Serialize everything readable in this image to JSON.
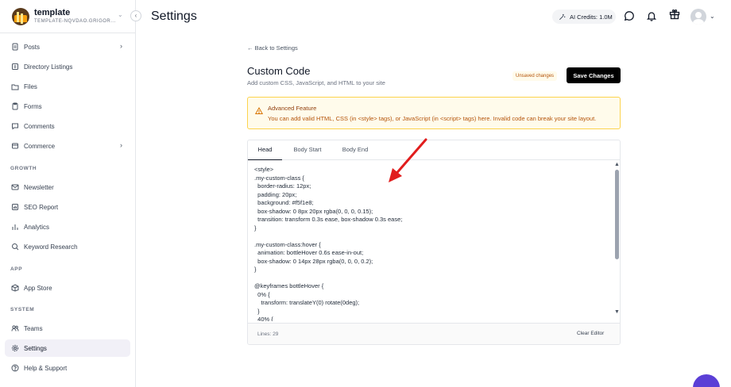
{
  "brand": {
    "name": "template",
    "subtitle": "TEMPLATE-NQVDAO.GRIGOR..."
  },
  "sidebar": {
    "items": [
      {
        "label": "Posts",
        "icon": "document-icon"
      },
      {
        "label": "Directory Listings",
        "icon": "list-icon"
      },
      {
        "label": "Files",
        "icon": "folder-icon"
      },
      {
        "label": "Forms",
        "icon": "clipboard-icon"
      },
      {
        "label": "Comments",
        "icon": "chat-icon"
      },
      {
        "label": "Commerce",
        "icon": "cart-icon"
      },
      {
        "label": "Newsletter",
        "icon": "mail-icon"
      },
      {
        "label": "SEO Report",
        "icon": "chart-icon"
      },
      {
        "label": "Analytics",
        "icon": "analytics-icon"
      },
      {
        "label": "Keyword Research",
        "icon": "search-icon"
      },
      {
        "label": "App Store",
        "icon": "box-icon"
      },
      {
        "label": "Teams",
        "icon": "users-icon"
      },
      {
        "label": "Settings",
        "icon": "gear-icon"
      },
      {
        "label": "Help & Support",
        "icon": "help-icon"
      }
    ],
    "sections": {
      "growth": "GROWTH",
      "app": "APP",
      "system": "SYSTEM"
    },
    "active": "Settings"
  },
  "header": {
    "title": "Settings",
    "credits": "AI Credits: 1.0M"
  },
  "main": {
    "back_link": "← Back to Settings",
    "title": "Custom Code",
    "description": "Add custom CSS, JavaScript, and HTML to your site",
    "unsaved": "Unsaved changes",
    "save_label": "Save Changes",
    "alert": {
      "title": "Advanced Feature",
      "text": "You can add valid HTML, CSS (in <style> tags), or JavaScript (in <script> tags) here. Invalid code can break your site layout."
    },
    "tabs": [
      {
        "label": "Head"
      },
      {
        "label": "Body Start"
      },
      {
        "label": "Body End"
      }
    ],
    "active_tab": "Head",
    "code": "<style>\n.my-custom-class {\n  border-radius: 12px;\n  padding: 20px;\n  background: #f5f1e8;\n  box-shadow: 0 8px 20px rgba(0, 0, 0, 0.15);\n  transition: transform 0.3s ease, box-shadow 0.3s ease;\n}\n\n.my-custom-class:hover {\n  animation: bottleHover 0.6s ease-in-out;\n  box-shadow: 0 14px 28px rgba(0, 0, 0, 0.2);\n}\n\n@keyframes bottleHover {\n  0% {\n    transform: translateY(0) rotate(0deg);\n  }\n  40% {",
    "lines": "Lines: 29",
    "clear_label": "Clear Editor"
  },
  "colors": {
    "accent": "#000000",
    "active_nav": "#f1f0f7",
    "warning_bg": "#fffbeb",
    "warning_border": "#fcd34d",
    "arrow": "#e11d1d"
  }
}
